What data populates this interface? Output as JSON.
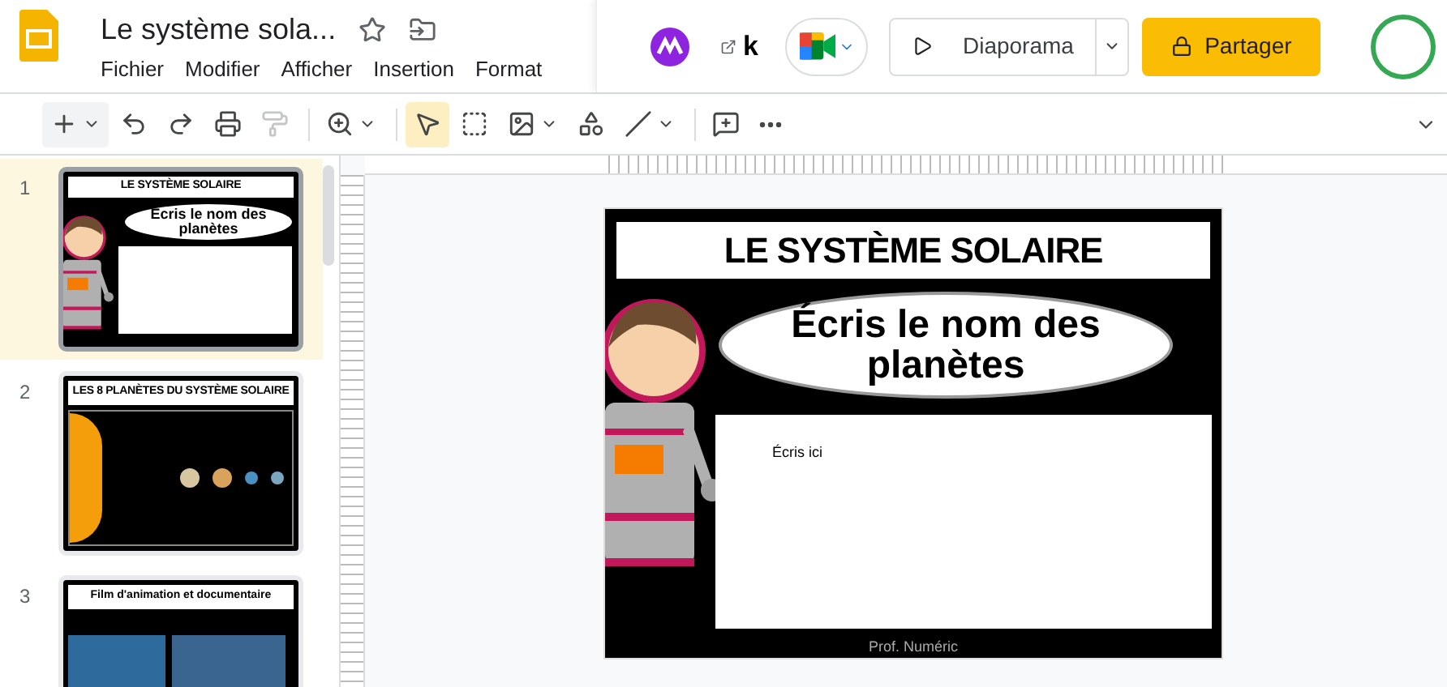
{
  "app": {
    "title": "Le système sola...",
    "menu": [
      "Fichier",
      "Modifier",
      "Afficher",
      "Insertion",
      "Format"
    ]
  },
  "header": {
    "extension_label": "k",
    "present_button": "Diaporama",
    "share_button": "Partager"
  },
  "toolbar": [
    {
      "kind": "add",
      "selected": false,
      "disabled": false
    },
    {
      "kind": "undo",
      "selected": false,
      "disabled": false
    },
    {
      "kind": "redo",
      "selected": false,
      "disabled": false
    },
    {
      "kind": "print",
      "selected": false,
      "disabled": false
    },
    {
      "kind": "paint",
      "selected": false,
      "disabled": true
    },
    {
      "kind": "zoom",
      "selected": false,
      "disabled": false
    },
    {
      "kind": "select",
      "selected": true,
      "disabled": false
    },
    {
      "kind": "textbox",
      "selected": false,
      "disabled": false
    },
    {
      "kind": "image",
      "selected": false,
      "disabled": false
    },
    {
      "kind": "shape",
      "selected": false,
      "disabled": false
    },
    {
      "kind": "line",
      "selected": false,
      "disabled": false
    },
    {
      "kind": "comment",
      "selected": false,
      "disabled": false
    },
    {
      "kind": "more",
      "selected": false,
      "disabled": false
    }
  ],
  "filmstrip": [
    {
      "number": "1",
      "selected": true,
      "kind": "title",
      "title": "LE SYSTÈME SOLAIRE",
      "subtitle": "Écris le nom des planètes"
    },
    {
      "number": "2",
      "selected": false,
      "kind": "planets",
      "title": "LES 8 PLANÈTES DU SYSTÈME SOLAIRE"
    },
    {
      "number": "3",
      "selected": false,
      "kind": "film",
      "title": "Film d'animation et documentaire"
    }
  ],
  "slide": {
    "title": "LE SYSTÈME SOLAIRE",
    "bubble": "Écris le nom des planètes",
    "body": "Écris ici",
    "footer": "Prof. Numéric"
  }
}
